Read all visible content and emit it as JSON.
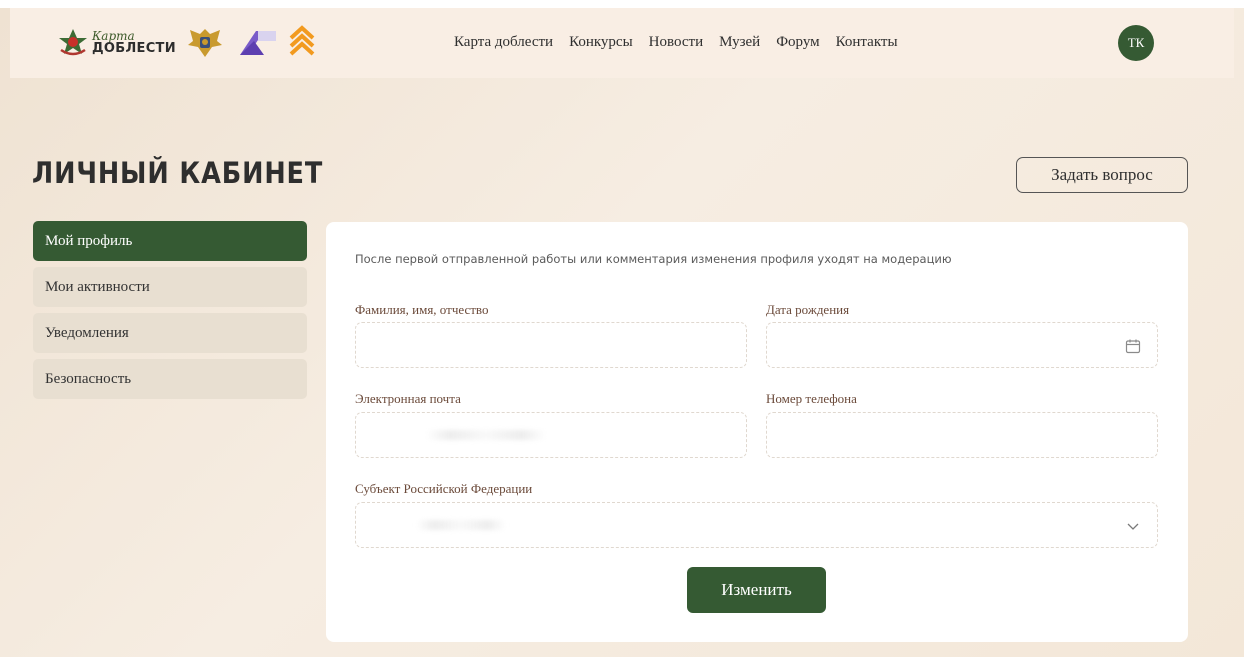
{
  "header": {
    "logo_script": "Карта",
    "logo_bold": "ДОБЛЕСТИ",
    "nav": [
      "Карта доблести",
      "Конкурсы",
      "Новости",
      "Музей",
      "Форум",
      "Контакты"
    ],
    "avatar_initials": "ТК"
  },
  "page": {
    "title": "ЛИЧНЫЙ КАБИНЕТ",
    "ask_button": "Задать вопрос"
  },
  "sidebar": {
    "items": [
      {
        "label": "Мой профиль",
        "active": true
      },
      {
        "label": "Мои активности",
        "active": false
      },
      {
        "label": "Уведомления",
        "active": false
      },
      {
        "label": "Безопасность",
        "active": false
      }
    ]
  },
  "form": {
    "notice": "После первой отправленной работы или комментария изменения профиля уходят на модерацию",
    "fields": {
      "full_name": {
        "label": "Фамилия, имя, отчество",
        "value": ""
      },
      "birth_date": {
        "label": "Дата рождения",
        "value": ""
      },
      "email": {
        "label": "Электронная почта",
        "value": ""
      },
      "phone": {
        "label": "Номер телефона",
        "value": ""
      },
      "region": {
        "label": "Субъект Российской Федерации",
        "value": ""
      }
    },
    "submit_label": "Изменить"
  },
  "colors": {
    "accent_green": "#355a33",
    "background": "#f3e9dd",
    "sidebar_inactive": "#e8dfd1",
    "label_brown": "#6b4a3a"
  },
  "icons": [
    "star-emblem-icon",
    "eagle-crest-icon",
    "ribbon-logo-icon",
    "chevron-rank-icon",
    "calendar-icon",
    "chevron-down-icon"
  ]
}
